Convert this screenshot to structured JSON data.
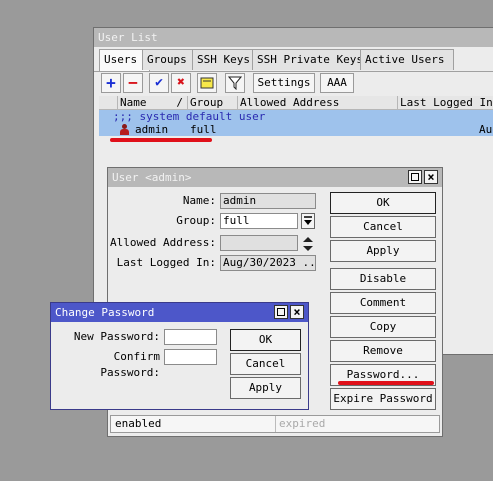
{
  "user_list": {
    "title": "User List",
    "tabs": [
      {
        "label": "Users"
      },
      {
        "label": "Groups"
      },
      {
        "label": "SSH Keys"
      },
      {
        "label": "SSH Private Keys"
      },
      {
        "label": "Active Users"
      }
    ],
    "toolbar": {
      "add_glyph": "+",
      "remove_glyph": "−",
      "enable_glyph": "✔",
      "disable_glyph": "✖",
      "settings_label": "Settings",
      "aaa_label": "AAA"
    },
    "columns": {
      "name": "Name",
      "sort_glyph": "/",
      "group": "Group",
      "allowed_address": "Allowed Address",
      "last_logged_in": "Last Logged In"
    },
    "comment_row": ";;; system default user",
    "rows": [
      {
        "name": "admin",
        "group": "full",
        "last_logged_in": "Aug"
      }
    ]
  },
  "user_dialog": {
    "title": "User <admin>",
    "fields": {
      "name_label": "Name:",
      "name_value": "admin",
      "group_label": "Group:",
      "group_value": "full",
      "allowed_label": "Allowed Address:",
      "allowed_value": "",
      "last_label": "Last Logged In:",
      "last_value": "Aug/30/2023 ..."
    },
    "buttons": {
      "ok": "OK",
      "cancel": "Cancel",
      "apply": "Apply",
      "disable": "Disable",
      "comment": "Comment",
      "copy": "Copy",
      "remove": "Remove",
      "password": "Password...",
      "expire": "Expire Password"
    },
    "status_left": "enabled",
    "status_right": "expired"
  },
  "password_dialog": {
    "title": "Change Password",
    "new_label": "New Password:",
    "new_value": "",
    "confirm_label": "Confirm Password:",
    "confirm_value": "",
    "buttons": {
      "ok": "OK",
      "cancel": "Cancel",
      "apply": "Apply"
    }
  },
  "colors": {
    "active_title": "#4d57c9",
    "inactive_title": "#b8b8b8",
    "selected_row": "#9ec2ec",
    "annotation_red": "#e0101a"
  }
}
